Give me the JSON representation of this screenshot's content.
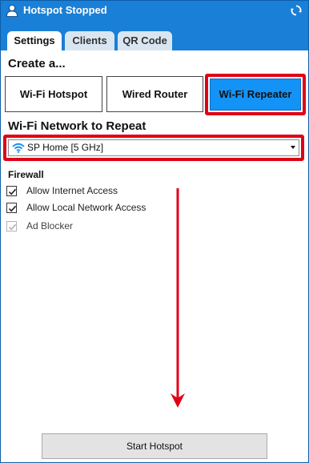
{
  "window": {
    "title": "Hotspot Stopped"
  },
  "tabs": [
    {
      "label": "Settings",
      "active": true
    },
    {
      "label": "Clients",
      "active": false
    },
    {
      "label": "QR Code",
      "active": false
    }
  ],
  "create": {
    "heading": "Create a...",
    "modes": [
      {
        "label": "Wi-Fi Hotspot",
        "selected": false
      },
      {
        "label": "Wired Router",
        "selected": false
      },
      {
        "label": "Wi-Fi Repeater",
        "selected": true
      }
    ]
  },
  "network": {
    "heading": "Wi-Fi Network to Repeat",
    "selected": "SP Home [5 GHz]",
    "icon": "wifi-icon"
  },
  "firewall": {
    "heading": "Firewall",
    "options": [
      {
        "label": "Allow Internet Access",
        "checked": true,
        "enabled": true
      },
      {
        "label": "Allow Local Network Access",
        "checked": true,
        "enabled": true
      },
      {
        "label": "Ad Blocker",
        "checked": true,
        "enabled": false
      }
    ]
  },
  "footer": {
    "start_label": "Start Hotspot"
  },
  "colors": {
    "header_blue": "#1a7fd6",
    "selected_mode_blue": "#1493f6",
    "highlight_red": "#e00016"
  }
}
